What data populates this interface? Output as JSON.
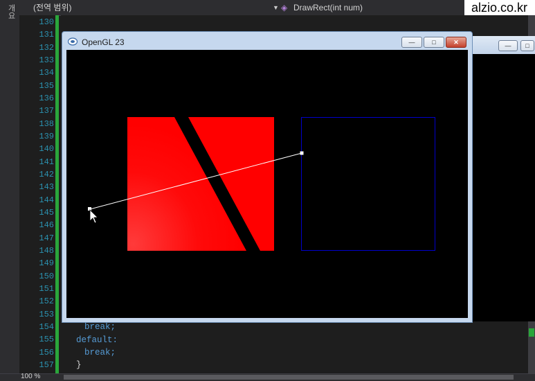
{
  "ide": {
    "rail_label": "개요",
    "scope_dropdown": "(전역 범위)",
    "member_dropdown": "DrawRect(int num)",
    "zoom": "100 %",
    "line_numbers": [
      "130",
      "131",
      "132",
      "133",
      "134",
      "135",
      "136",
      "137",
      "138",
      "139",
      "140",
      "141",
      "142",
      "143",
      "144",
      "145",
      "146",
      "147",
      "148",
      "149",
      "150",
      "151",
      "152",
      "153",
      "154",
      "155",
      "156",
      "157"
    ],
    "code_break_1": "break;",
    "code_default": "default:",
    "code_break_2": "break;",
    "code_brace": "}"
  },
  "watermark": "alzio.co.kr",
  "gl_window": {
    "title": "OpenGL 23",
    "min_glyph": "—",
    "max_glyph": "□",
    "close_glyph": "✕"
  },
  "bg_window": {
    "min_glyph": "—",
    "max_glyph": "□"
  },
  "colors": {
    "red_fill": "#ff0000",
    "blue_outline": "#0000cc",
    "line_color": "#ffffff",
    "line_number": "#2b91af",
    "keyword": "#569cd6"
  }
}
